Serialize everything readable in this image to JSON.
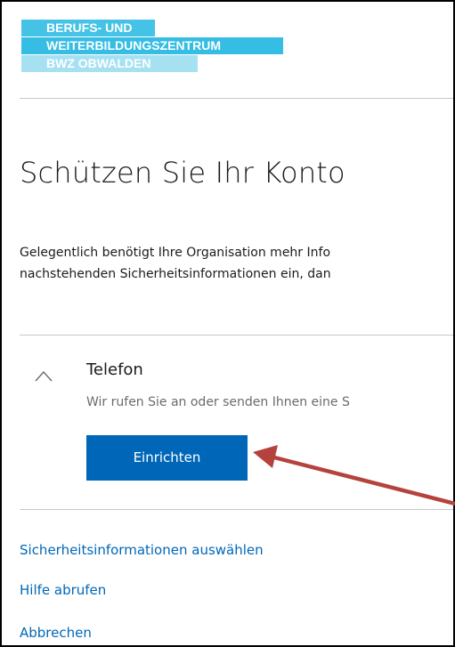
{
  "logo": {
    "line1": "BERUFS- UND",
    "line2": "WEITERBILDUNGSZENTRUM",
    "line3": "BWZ OBWALDEN"
  },
  "page": {
    "title": "Schützen Sie Ihr Konto",
    "description_line1": "Gelegentlich benötigt Ihre Organisation mehr Info",
    "description_line2": "nachstehenden Sicherheitsinformationen ein, dan"
  },
  "method": {
    "icon": "chevron-up-icon",
    "title": "Telefon",
    "subtitle": "Wir rufen Sie an oder senden Ihnen eine S",
    "button_label": "Einrichten"
  },
  "links": {
    "choose_security_info": "Sicherheitsinformationen auswählen",
    "get_help": "Hilfe abrufen",
    "cancel": "Abbrechen"
  },
  "annotation": {
    "icon": "annotation-arrow-icon",
    "color": "#b5423c"
  },
  "colors": {
    "accent": "#0067b8",
    "logo_blue": "#36bde3",
    "logo_light": "#a6e1f2",
    "divider": "#c8c8c8"
  }
}
